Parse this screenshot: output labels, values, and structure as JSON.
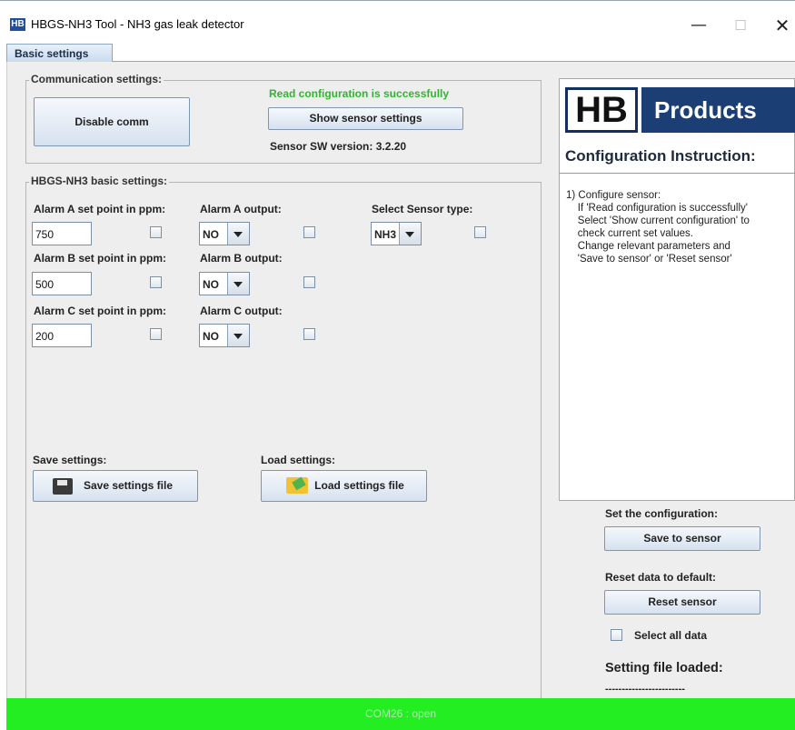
{
  "window": {
    "icon_text": "HB",
    "title": "HBGS-NH3 Tool - NH3 gas leak detector",
    "minimize": "—",
    "maximize": "☐",
    "close": "✕"
  },
  "tabs": [
    {
      "label": "Basic settings"
    }
  ],
  "communication": {
    "legend": "Communication settings:",
    "disable_button": "Disable comm",
    "read_status": "Read configuration is successfully",
    "read_status_color": "#2db82d",
    "show_sensor_button": "Show sensor settings",
    "sw_version": "Sensor SW version: 3.2.20"
  },
  "basic_settings": {
    "legend": "HBGS-NH3 basic settings:",
    "alarm_a": {
      "label": "Alarm A set point in ppm:",
      "value": "750",
      "output_label": "Alarm A output:",
      "output_value": "NO"
    },
    "alarm_b": {
      "label": "Alarm B set point in ppm:",
      "value": "500",
      "output_label": "Alarm B output:",
      "output_value": "NO"
    },
    "alarm_c": {
      "label": "Alarm C set point in ppm:",
      "value": "200",
      "output_label": "Alarm C output:",
      "output_value": "NO"
    },
    "sensor_type": {
      "label": "Select Sensor type:",
      "value": "NH3"
    },
    "save": {
      "label": "Save settings:",
      "button": "Save settings file",
      "icon": "floppy-disk-icon"
    },
    "load": {
      "label": "Load settings:",
      "button": "Load settings file",
      "icon": "open-folder-icon"
    }
  },
  "instructions": {
    "logo_left": "HB",
    "logo_right": "Products",
    "title": "Configuration Instruction:",
    "text": "1) Configure sensor:\n    If 'Read configuration is successfully'\n    Select 'Show current configuration' to\n    check current set values.\n    Change relevant parameters and\n    'Save to sensor' or 'Reset sensor'"
  },
  "actions": {
    "set_config_label": "Set the configuration:",
    "save_to_sensor": "Save to sensor",
    "reset_label": "Reset data to default:",
    "reset_sensor": "Reset sensor",
    "select_all": "Select all data",
    "setting_file_loaded": "Setting file loaded:",
    "setting_file_value": "------------------------"
  },
  "status_bar": {
    "text": "COM26 : open",
    "color": "#22ee22"
  }
}
